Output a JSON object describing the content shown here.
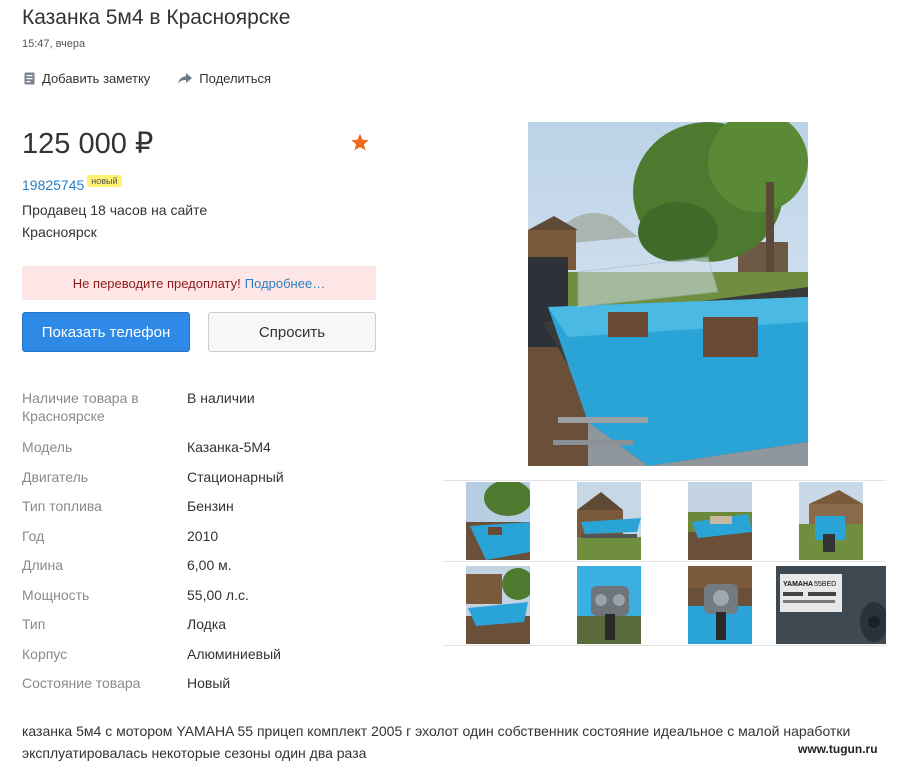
{
  "listing": {
    "title": "Казанка 5м4 в Красноярске",
    "posted": "15:47, вчера",
    "price": "125 000 ₽",
    "ad_id": "19825745",
    "badge": "новый",
    "seller_status": "Продавец 18 часов на сайте",
    "city": "Красноярск",
    "description": "казанка 5м4 с мотором YAMAHA 55 прицеп комплект 2005 г эхолот один собственник состояние идеальное с малой наработки эксплуатировалась некоторые сезоны один два раза"
  },
  "actions": {
    "add_note": "Добавить заметку",
    "share": "Поделиться"
  },
  "warning": {
    "text": "Не переводите предоплату!",
    "link": "Подробнее…"
  },
  "buttons": {
    "show_phone": "Показать телефон",
    "ask": "Спросить"
  },
  "params": [
    {
      "key": "Наличие товара в Красноярске",
      "value": "В наличии"
    },
    {
      "key": "Модель",
      "value": "Казанка-5М4"
    },
    {
      "key": "Двигатель",
      "value": "Стационарный"
    },
    {
      "key": "Тип топлива",
      "value": "Бензин"
    },
    {
      "key": "Год",
      "value": "2010"
    },
    {
      "key": "Длина",
      "value": "6,00 м."
    },
    {
      "key": "Мощность",
      "value": "55,00 л.с."
    },
    {
      "key": "Тип",
      "value": "Лодка"
    },
    {
      "key": "Корпус",
      "value": "Алюминиевый"
    },
    {
      "key": "Состояние товара",
      "value": "Новый"
    }
  ],
  "thumbnail_label": {
    "brand": "YAMAHA",
    "model": "55BED"
  },
  "watermark": "www.tugun.ru",
  "colors": {
    "link": "#2a7fc3",
    "primary_button": "#2e8ae6",
    "warning_bg": "#ffe6e6",
    "badge_bg": "#fff172",
    "star": "#f26a1b"
  }
}
